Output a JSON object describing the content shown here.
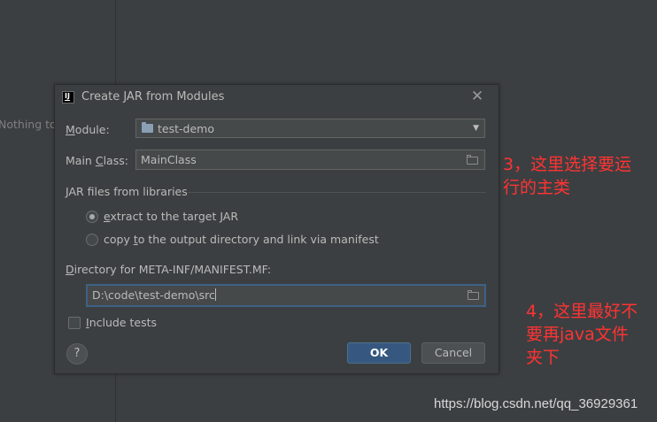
{
  "background": {
    "left_panel_text": "Nothing to"
  },
  "dialog": {
    "title": "Create JAR from Modules",
    "icon_text": "IJ",
    "module": {
      "label_prefix": "",
      "label_mnemonic": "M",
      "label_rest": "odule:",
      "value": "test-demo"
    },
    "main_class": {
      "label_prefix": "Main ",
      "label_mnemonic": "C",
      "label_rest": "lass:",
      "value": "MainClass"
    },
    "jar_section": "JAR files from libraries",
    "radio_extract": {
      "mnemonic": "e",
      "rest": "xtract to the target JAR",
      "checked": true
    },
    "radio_copy": {
      "prefix": "copy ",
      "mnemonic": "t",
      "rest": "o the output directory and link via manifest",
      "checked": false
    },
    "manifest_dir": {
      "label_mnemonic": "D",
      "label_rest": "irectory for META-INF/MANIFEST.MF:",
      "value": "D:\\code\\test-demo\\src"
    },
    "include_tests": {
      "mnemonic": "I",
      "rest": "nclude tests",
      "checked": false
    },
    "help_label": "?",
    "ok_label": "OK",
    "cancel_label": "Cancel"
  },
  "annotations": {
    "note3_line1": "3，这里选择要运",
    "note3_line2": "行的主类",
    "note4_line1": "4，这里最好不",
    "note4_line2": "要再java文件",
    "note4_line3": "夹下"
  },
  "watermark": "https://blog.csdn.net/qq_36929361",
  "colors": {
    "background": "#3c3f41",
    "field": "#45494a",
    "ok_button": "#365880",
    "focus_border": "#3d6185",
    "annotation": "#ff3333"
  }
}
